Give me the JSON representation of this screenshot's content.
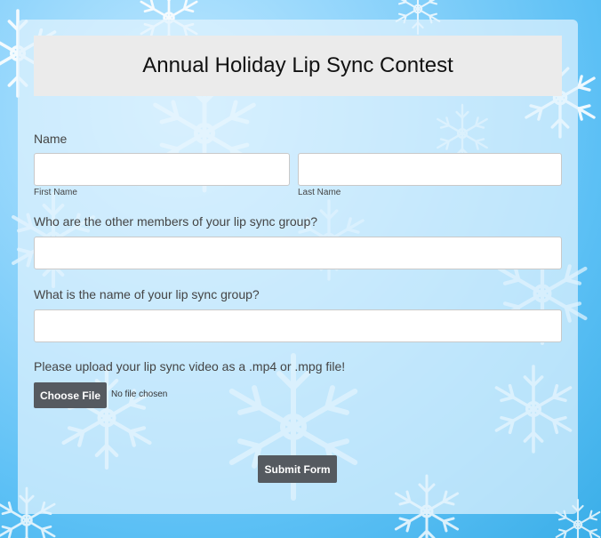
{
  "form": {
    "title": "Annual Holiday Lip Sync Contest",
    "name_label": "Name",
    "first_name": {
      "sublabel": "First Name",
      "value": ""
    },
    "last_name": {
      "sublabel": "Last Name",
      "value": ""
    },
    "members_label": "Who are the other members of your lip sync group?",
    "members_value": "",
    "group_name_label": "What is the name of your lip sync group?",
    "group_name_value": "",
    "upload_label": "Please upload your lip sync video as a .mp4 or .mpg file!",
    "choose_file_label": "Choose File",
    "no_file_text": "No file chosen",
    "submit_label": "Submit Form"
  },
  "background": {
    "theme": "snowflakes",
    "colors": {
      "sky": "#5cc0f5",
      "flake": "#ffffff",
      "card": "#e1f3fd",
      "header": "#ebebeb",
      "button": "#555a60"
    }
  }
}
